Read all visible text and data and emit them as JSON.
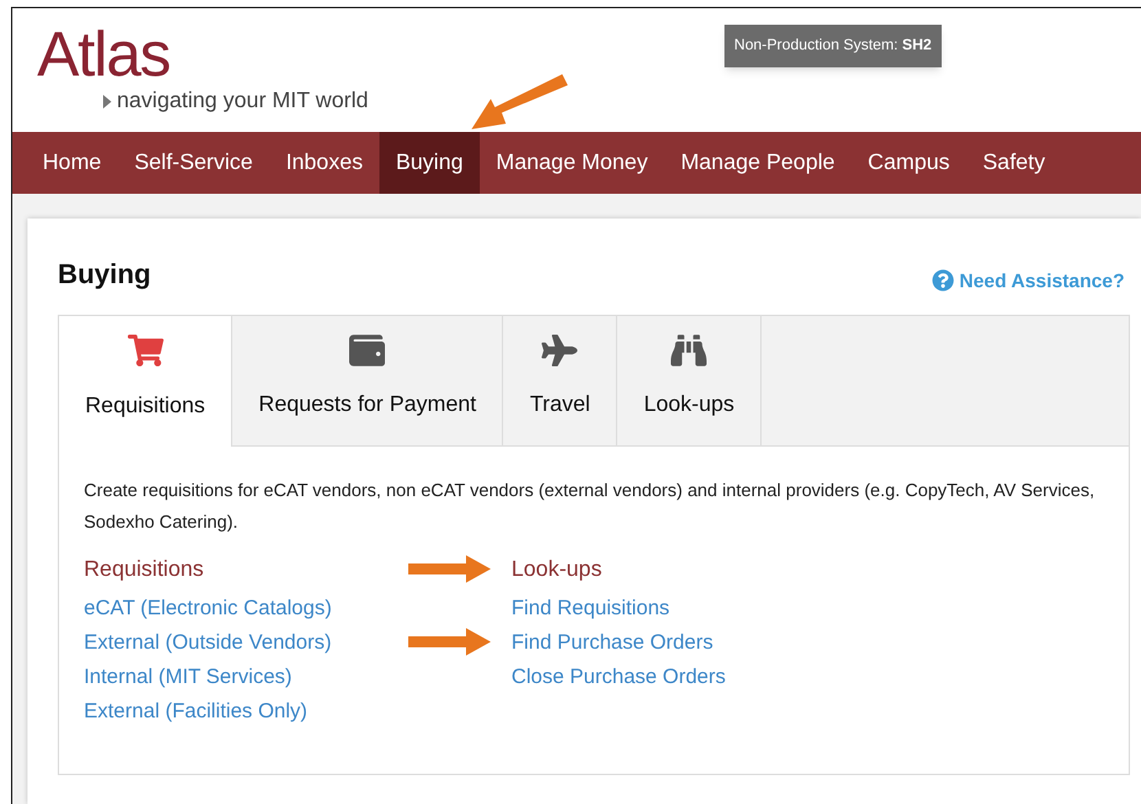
{
  "logo": {
    "name": "Atlas",
    "tagline": "navigating your MIT world"
  },
  "environment_badge": {
    "label": "Non-Production System:",
    "system": "SH2"
  },
  "nav": [
    {
      "label": "Home",
      "selected": false
    },
    {
      "label": "Self-Service",
      "selected": false
    },
    {
      "label": "Inboxes",
      "selected": false
    },
    {
      "label": "Buying",
      "selected": true
    },
    {
      "label": "Manage Money",
      "selected": false
    },
    {
      "label": "Manage People",
      "selected": false
    },
    {
      "label": "Campus",
      "selected": false
    },
    {
      "label": "Safety",
      "selected": false
    }
  ],
  "page_title": "Buying",
  "help_link": "Need Assistance?",
  "tabs": [
    {
      "label": "Requisitions",
      "selected": true
    },
    {
      "label": "Requests for Payment",
      "selected": false
    },
    {
      "label": "Travel",
      "selected": false
    },
    {
      "label": "Look-ups",
      "selected": false
    }
  ],
  "description": "Create requisitions for eCAT vendors, non eCAT vendors (external vendors) and internal providers (e.g. CopyTech, AV Services, Sodexho Catering).",
  "link_groups": [
    {
      "heading": "Requisitions",
      "links": [
        {
          "label": "eCAT (Electronic Catalogs)",
          "annotated": false
        },
        {
          "label": "External (Outside Vendors)",
          "annotated": false
        },
        {
          "label": "Internal (MIT Services)",
          "annotated": false
        },
        {
          "label": "External (Facilities Only)",
          "annotated": false
        }
      ]
    },
    {
      "heading": "Look-ups",
      "annotated": true,
      "links": [
        {
          "label": "Find Requisitions",
          "annotated": false
        },
        {
          "label": "Find Purchase Orders",
          "annotated": true
        },
        {
          "label": "Close Purchase Orders",
          "annotated": false
        }
      ]
    }
  ]
}
